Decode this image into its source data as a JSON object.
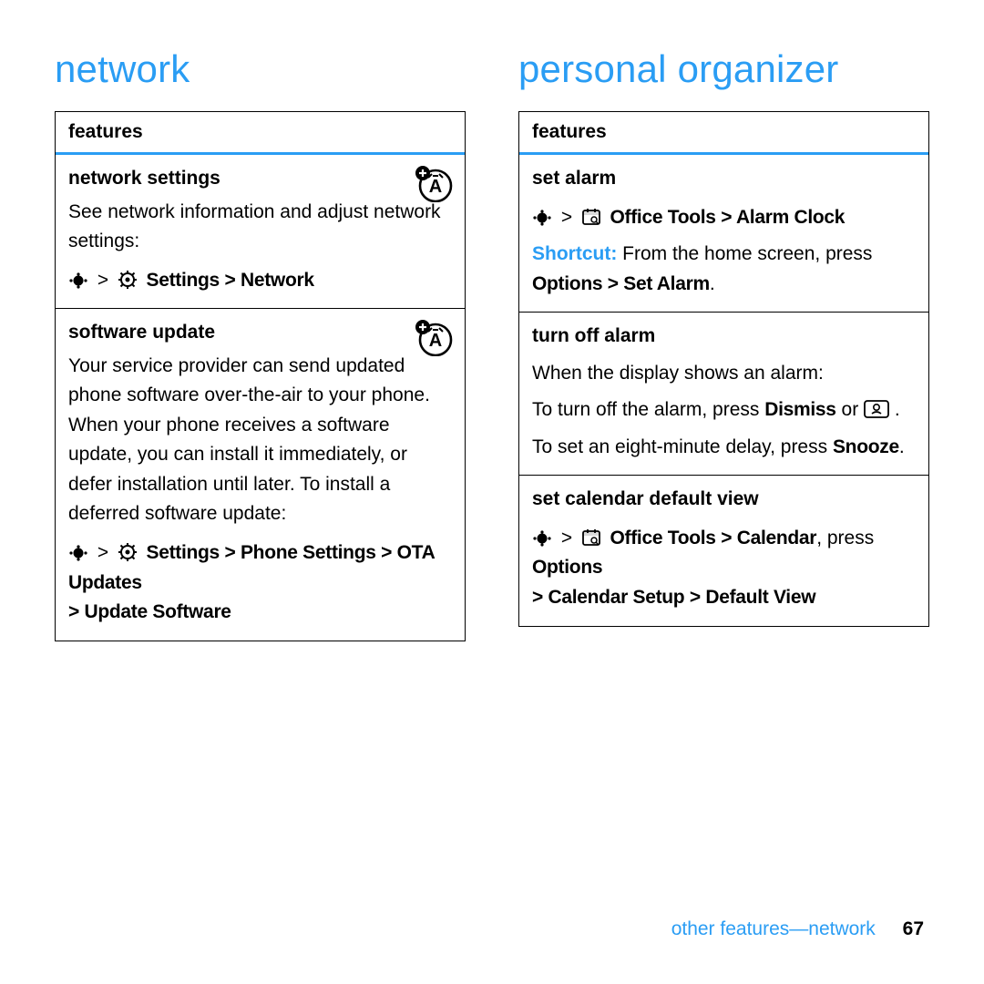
{
  "left": {
    "heading": "network",
    "features_label": "features",
    "r1": {
      "title": "network settings",
      "desc": "See network information and adjust network settings:",
      "path": "Settings > Network"
    },
    "r2": {
      "title": "software update",
      "para": "Your service provider can send updated phone software over-the-air to your phone. When your phone receives a software update, you can install it immediately, or defer installation until later. To install a deferred software update:",
      "path1": "Settings > Phone Settings > OTA Updates",
      "path2": "> Update Software"
    }
  },
  "right": {
    "heading": "personal organizer",
    "features_label": "features",
    "r1": {
      "title": "set alarm",
      "path": "Office Tools > Alarm Clock",
      "shortcut_label": "Shortcut:",
      "shortcut_text": " From the home screen, press ",
      "shortcut_path": "Options > Set Alarm",
      "period": "."
    },
    "r2": {
      "title": "turn off alarm",
      "l1": "When the display shows an alarm:",
      "l2a": "To turn off the alarm, press ",
      "dismiss": "Dismiss",
      "or": " or ",
      "dot": " .",
      "l3a": "To set an eight-minute delay, press ",
      "snooze": "Snooze",
      "l3b": "."
    },
    "r3": {
      "title": "set calendar default view",
      "path1a": "Office Tools > Calendar",
      "path1b": ", press ",
      "path1c": "Options",
      "path2": "> Calendar Setup > Default View"
    }
  },
  "footer": {
    "label": "other features—network",
    "page": "67"
  }
}
